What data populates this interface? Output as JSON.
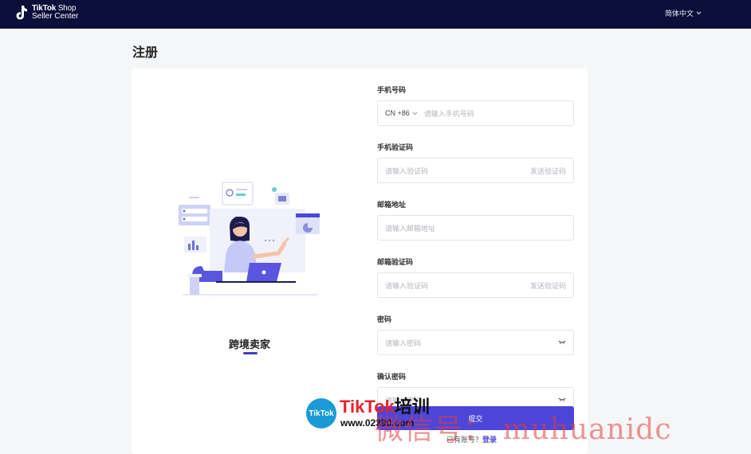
{
  "header": {
    "logo_title_bold": "TikTok",
    "logo_title_light": " Shop",
    "logo_subtitle": "Seller Center",
    "language": "简体中文"
  },
  "page_title": "注册",
  "role": {
    "label": "跨境卖家"
  },
  "form": {
    "phone": {
      "label": "手机号码",
      "country_code": "CN +86",
      "placeholder": "请输入手机号码"
    },
    "phone_code": {
      "label": "手机验证码",
      "placeholder": "请输入验证码",
      "send": "发送验证码"
    },
    "email": {
      "label": "邮箱地址",
      "placeholder": "请输入邮箱地址"
    },
    "email_code": {
      "label": "邮箱验证码",
      "placeholder": "请输入验证码",
      "send": "发送验证码"
    },
    "password": {
      "label": "密码",
      "placeholder": "请输入密码"
    },
    "confirm_password": {
      "label": "确认密码",
      "placeholder": "请输入密码"
    },
    "submit": "提交",
    "have_account": "已有账号？",
    "login": "登录"
  },
  "watermark": {
    "badge": "TikTok",
    "title_en": "TikTok",
    "title_cn": "培训",
    "url": "www.02390.com",
    "wechat": "微信号： muhuanidc"
  },
  "colors": {
    "topbar": "#0c0f3a",
    "primary": "#4d46d9",
    "accent_underline": "#3d3fbf"
  }
}
